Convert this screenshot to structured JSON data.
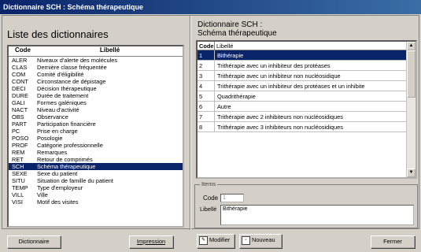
{
  "window": {
    "title": "Dictionnaire SCH : Schéma thérapeutique"
  },
  "left": {
    "title": "Liste des dictionnaires",
    "headers": {
      "code": "Code",
      "label": "Libellé"
    },
    "items": [
      {
        "code": "ALER",
        "label": "Niveaux d'alerte des molécules"
      },
      {
        "code": "CLAS",
        "label": "Dernière classe fréquentée"
      },
      {
        "code": "COM",
        "label": "Comité d'éligibilité"
      },
      {
        "code": "CONT",
        "label": "Circonstance de dépistage"
      },
      {
        "code": "DECI",
        "label": "Décision thérapeutique"
      },
      {
        "code": "DURE",
        "label": "Durée de traitement"
      },
      {
        "code": "GALI",
        "label": "Formes galéniques"
      },
      {
        "code": "NACT",
        "label": "Niveau d'activité"
      },
      {
        "code": "OBS",
        "label": "Observance"
      },
      {
        "code": "PART",
        "label": "Participation financière"
      },
      {
        "code": "PC",
        "label": "Prise en charge"
      },
      {
        "code": "POSO",
        "label": "Posologie"
      },
      {
        "code": "PROF",
        "label": "Catégorie professionnelle"
      },
      {
        "code": "REM",
        "label": "Remarques"
      },
      {
        "code": "RET",
        "label": "Retour de comprimés"
      },
      {
        "code": "SCH",
        "label": "Schéma thérapeutique"
      },
      {
        "code": "SEXE",
        "label": "Sexe du patient"
      },
      {
        "code": "SITU",
        "label": "Situation de famille du patient"
      },
      {
        "code": "TEMP",
        "label": "Type d'employeur"
      },
      {
        "code": "VILL",
        "label": "Ville"
      },
      {
        "code": "VISI",
        "label": "Motif des visites"
      }
    ],
    "selected_code": "SCH"
  },
  "right": {
    "title_line1": "Dictionnaire SCH :",
    "title_line2": "Schéma thérapeutique",
    "headers": {
      "code": "Code",
      "label": "Libellé"
    },
    "rows": [
      {
        "code": "1",
        "label": "Bithérapie"
      },
      {
        "code": "2",
        "label": "Trithérapie avec un inhibiteur des protéases"
      },
      {
        "code": "3",
        "label": "Trithérapie avec un inhibiteur non nucléosidique"
      },
      {
        "code": "4",
        "label": "Trithérapie avec un inhibiteur des protéases et un inhibite"
      },
      {
        "code": "5",
        "label": "Quadrithérapie"
      },
      {
        "code": "6",
        "label": "Autre"
      },
      {
        "code": "7",
        "label": "Trithérapie avec 2 inhibiteurs non nucléosidiques"
      },
      {
        "code": "8",
        "label": "Trithérapie avec 3 inhibiteurs non nucléosidiques"
      }
    ],
    "selected_code": "1",
    "items": {
      "legend": "Items",
      "code_label": "Code",
      "code_value": "1",
      "label_label": "Libellé",
      "label_value": "Bithérapie"
    }
  },
  "buttons": {
    "dictionnaire": "Dictionnaire",
    "impression": "Impression",
    "modifier": "Modifier",
    "nouveau": "Nouveau",
    "fermer": "Fermer"
  },
  "colors": {
    "selection": "#0a246a",
    "face": "#d4d0c8"
  }
}
